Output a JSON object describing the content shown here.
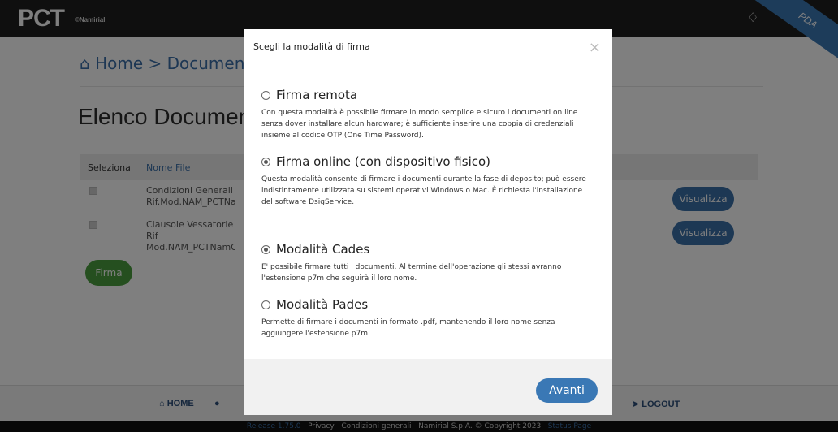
{
  "header": {
    "logo": "PCT",
    "logo_sub": "©Namirial",
    "ribbon": "PDA"
  },
  "breadcrumb": "Home > Documenta",
  "page_title": "Elenco Document",
  "table": {
    "headers": [
      "Seleziona",
      "Nome File"
    ],
    "rows": [
      {
        "name": "Condizioni Generali Rif.Mod.NAM_PCTNam",
        "action": "Visualizza"
      },
      {
        "name": "Clausole Vessatorie Rif Mod.NAM_PCTNamOr",
        "action": "Visualizza"
      }
    ]
  },
  "firma_button": "Firma",
  "footer": {
    "home": "HOME",
    "logout": "LOGOUT"
  },
  "bottombar": {
    "release": "Release 1.75.0",
    "privacy": "Privacy",
    "conditions": "Condizioni generali",
    "copyright": "Namirial S.p.A. © Copyright 2023",
    "status": "Status Page"
  },
  "modal": {
    "title": "Scegli la modalità di firma",
    "options": [
      {
        "label": "Firma remota",
        "desc": "Con questa modalità è possibile firmare in modo semplice e sicuro i documenti on line senza dover installare alcun hardware; è sufficiente inserire una coppia di credenziali insieme al codice OTP (One Time Password).",
        "checked": false
      },
      {
        "label": "Firma online (con dispositivo fisico)",
        "desc": "Questa modalità consente di firmare i documenti durante la fase di deposito; può essere indistintamente utilizzata su sistemi operativi Windows o Mac. È richiesta l'installazione del software DsigService.",
        "checked": true
      },
      {
        "label": "Modalità Cades",
        "desc": "E' possibile firmare tutti i documenti. Al termine dell'operazione gli stessi avranno l'estensione p7m che seguirà il loro nome.",
        "checked": true
      },
      {
        "label": "Modalità Pades",
        "desc": "Permette di firmare i documenti in formato .pdf, mantenendo il loro nome senza aggiungere l'estensione p7m.",
        "checked": false
      }
    ],
    "submit": "Avanti"
  }
}
